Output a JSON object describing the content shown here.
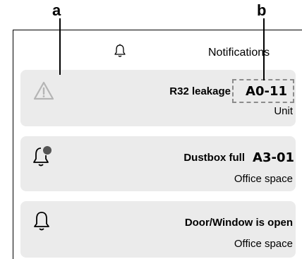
{
  "callouts": {
    "a": "a",
    "b": "b"
  },
  "header": {
    "title": "Notifications",
    "icon": "bell-icon"
  },
  "notifications": [
    {
      "icon": "warning-triangle-icon",
      "title": "R32 leakage",
      "code": "A0-11",
      "subtitle": "Unit"
    },
    {
      "icon": "bell-with-dot-icon",
      "title": "Dustbox full",
      "code": "A3-01",
      "subtitle": "Office space"
    },
    {
      "icon": "bell-icon",
      "title": "Door/Window is open",
      "code": "",
      "subtitle": "Office space"
    }
  ],
  "colors": {
    "card_background": "#ebebeb",
    "warning_icon": "#b5b5b5",
    "dashed_highlight": "#8c8c8c",
    "dot": "#555555"
  }
}
